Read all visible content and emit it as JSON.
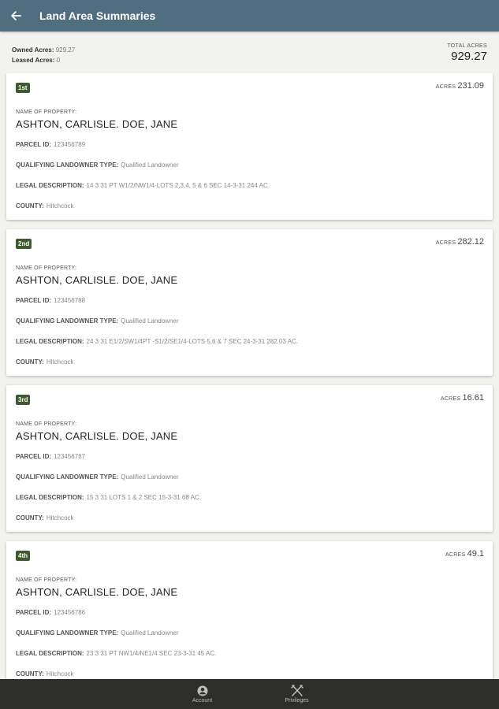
{
  "appbar": {
    "title": "Land Area Summaries"
  },
  "summary": {
    "owned_label": "Owned Acres:",
    "owned_value": "929.27",
    "leased_label": "Leased Acres:",
    "leased_value": "0",
    "total_label": "TOTAL ACRES",
    "total_value": "929.27"
  },
  "labels": {
    "acres": "ACRES",
    "name_of_property": "NAME OF PROPERTY:",
    "parcel_id": "PARCEL ID:",
    "qualifying": "QUALIFYING LANDOWNER TYPE:",
    "legal": "LEGAL DESCRIPTION:",
    "county": "COUNTY:"
  },
  "cards": [
    {
      "rank": "1st",
      "acres": "231.09",
      "name": "ASHTON, CARLISLE. DOE, JANE",
      "parcel_id": "123456789",
      "qualifying": "Qualified Landowner",
      "legal": "14 3 31 PT W1/2/NW1/4-LOTS 2,3,4, 5 & 6 SEC 14-3-31 244 AC.",
      "county": "Hitchcock"
    },
    {
      "rank": "2nd",
      "acres": "282.12",
      "name": "ASHTON, CARLISLE. DOE, JANE",
      "parcel_id": "123456788",
      "qualifying": "Qualified Landowner",
      "legal": "24 3 31 E1/2/SW1/4PT -S1/2/SE1/4-LOTS 5,6 & 7 SEC 24-3-31 282.03 AC.",
      "county": "Hitchcock"
    },
    {
      "rank": "3rd",
      "acres": "16.61",
      "name": "ASHTON, CARLISLE. DOE, JANE",
      "parcel_id": "123456787",
      "qualifying": "Qualified Landowner",
      "legal": "15 3 31 LOTS 1 & 2 SEC 15-3-31 68 AC.",
      "county": "Hitchcock"
    },
    {
      "rank": "4th",
      "acres": "49.1",
      "name": "ASHTON, CARLISLE. DOE, JANE",
      "parcel_id": "123456786",
      "qualifying": "Qualified Landowner",
      "legal": "23 3 31 PT NW1/4/NE1/4 SEC 23-3-31 45 AC.",
      "county": "Hitchcock"
    }
  ],
  "bottom_nav": [
    {
      "label": "Account",
      "icon": "account-icon"
    },
    {
      "label": "Privileges",
      "icon": "privileges-icon"
    }
  ],
  "colors": {
    "appbar": "#4f6e7f",
    "rank_badge": "#3e5a2e",
    "bottom_nav": "#2d2d2b"
  }
}
